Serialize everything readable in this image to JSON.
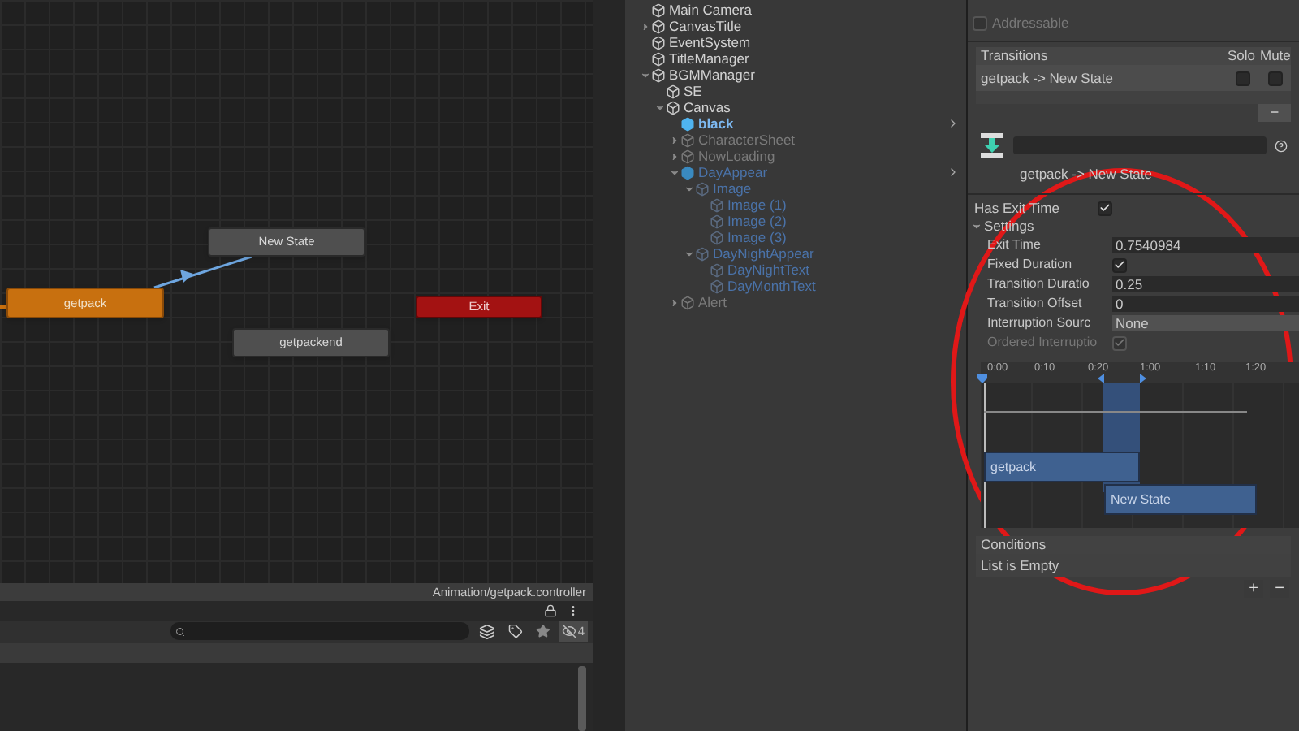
{
  "animator": {
    "nodes": [
      {
        "label": "New State",
        "kind": "state"
      },
      {
        "label": "getpack",
        "kind": "default"
      },
      {
        "label": "Exit",
        "kind": "exit"
      },
      {
        "label": "getpackend",
        "kind": "state"
      }
    ],
    "breadcrumb": "Animation/getpack.controller",
    "hidden_count": "4"
  },
  "hierarchy": {
    "items": [
      {
        "label": "Main Camera",
        "kind": "object"
      },
      {
        "label": "CanvasTitle",
        "kind": "object",
        "expanded": false
      },
      {
        "label": "EventSystem",
        "kind": "object"
      },
      {
        "label": "TitleManager",
        "kind": "object"
      },
      {
        "label": "BGMManager",
        "kind": "object",
        "expanded": true,
        "children": [
          {
            "label": "SE",
            "kind": "object"
          },
          {
            "label": "Canvas",
            "kind": "object",
            "expanded": true,
            "children": [
              {
                "label": "black",
                "kind": "prefab_root"
              },
              {
                "label": "CharacterSheet",
                "kind": "inactive",
                "expanded": false
              },
              {
                "label": "NowLoading",
                "kind": "inactive",
                "expanded": false
              },
              {
                "label": "DayAppear",
                "kind": "prefab_root_inactive",
                "expanded": true,
                "children": [
                  {
                    "label": "Image",
                    "kind": "prefab_inactive",
                    "expanded": true,
                    "children": [
                      {
                        "label": "Image (1)",
                        "kind": "prefab_inactive"
                      },
                      {
                        "label": "Image (2)",
                        "kind": "prefab_inactive"
                      },
                      {
                        "label": "Image (3)",
                        "kind": "prefab_inactive"
                      }
                    ]
                  },
                  {
                    "label": "DayNightAppear",
                    "kind": "prefab_inactive",
                    "expanded": true,
                    "children": [
                      {
                        "label": "DayNightText",
                        "kind": "prefab_inactive"
                      },
                      {
                        "label": "DayMonthText",
                        "kind": "prefab_inactive"
                      }
                    ]
                  }
                ]
              },
              {
                "label": "Alert",
                "kind": "inactive",
                "expanded": false
              }
            ]
          }
        ]
      }
    ]
  },
  "inspector": {
    "addressable": {
      "label": "Addressable",
      "checked": false,
      "disabled": true
    },
    "transitions": {
      "header": "Transitions",
      "solo_label": "Solo",
      "mute_label": "Mute",
      "rows": [
        {
          "name": "getpack -> New State",
          "solo": false,
          "mute": false,
          "selected": true
        }
      ],
      "remove_button": "−"
    },
    "transition_name": "getpack -> New State",
    "has_exit_time": {
      "label": "Has Exit Time",
      "checked": true
    },
    "settings": {
      "label": "Settings",
      "expanded": true,
      "fields": [
        {
          "kind": "number",
          "label": "Exit Time",
          "value": "0.7540984"
        },
        {
          "kind": "checkbox",
          "label": "Fixed Duration",
          "checked": true,
          "disabled": false
        },
        {
          "kind": "number",
          "label": "Transition Duratio",
          "value": "0.25"
        },
        {
          "kind": "number",
          "label": "Transition Offset",
          "value": "0"
        },
        {
          "kind": "dropdown",
          "label": "Interruption Sourc",
          "value": "None"
        },
        {
          "kind": "checkbox",
          "label": "Ordered Interruptio",
          "checked": true,
          "disabled": true
        }
      ]
    },
    "timeline": {
      "ticks": [
        "0:00",
        "0:10",
        "0:20",
        "1:00",
        "1:10",
        "1:20"
      ],
      "tracks": [
        {
          "label": "getpack"
        },
        {
          "label": "New State"
        }
      ]
    },
    "conditions": {
      "header": "Conditions",
      "empty_text": "List is Empty",
      "add_button": "+",
      "remove_button": "−"
    }
  }
}
